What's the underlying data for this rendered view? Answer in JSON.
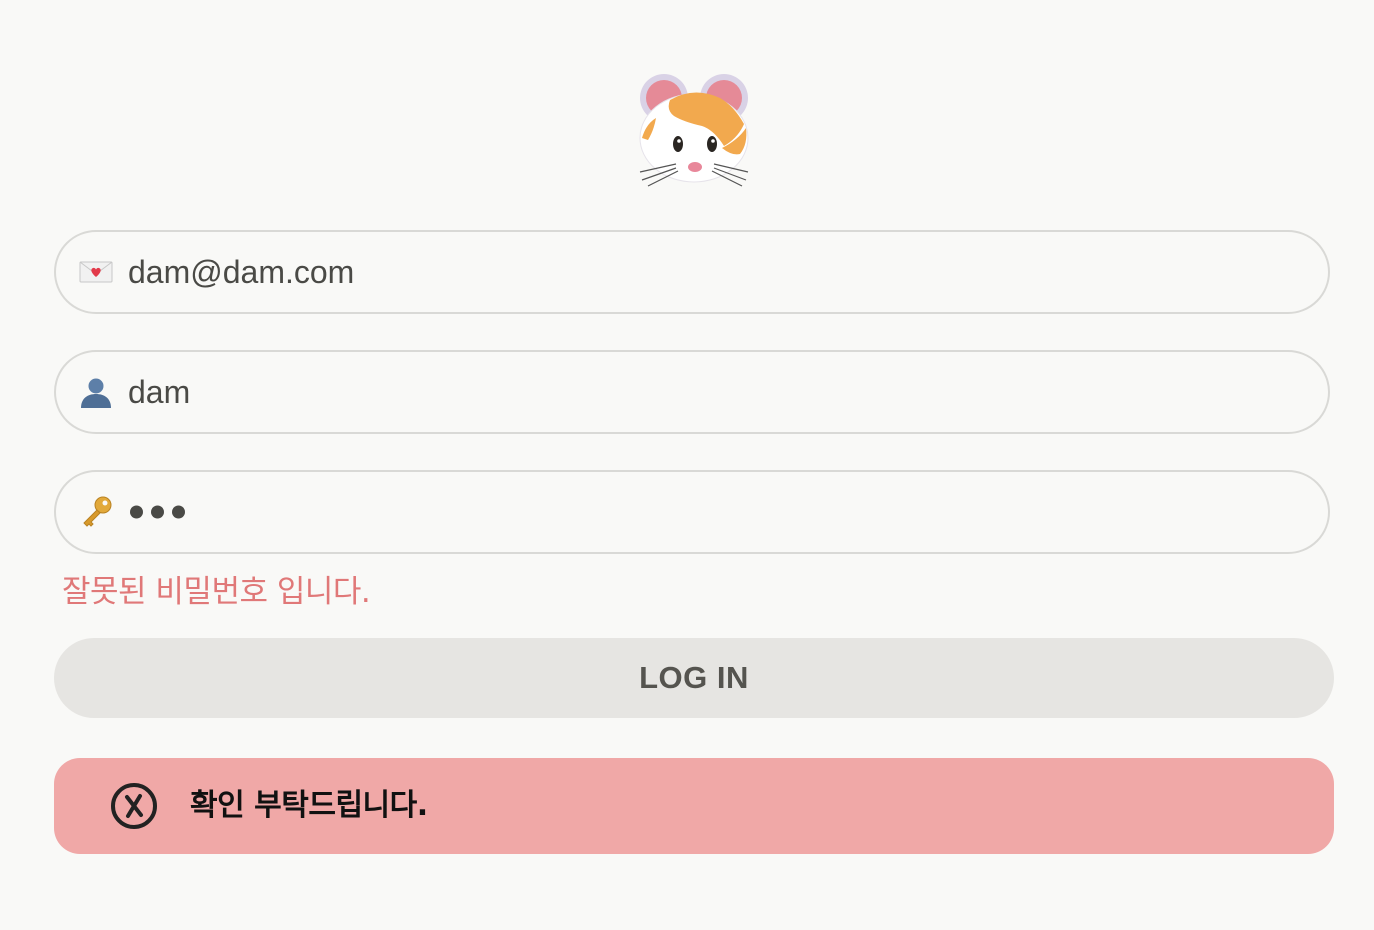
{
  "logo": {
    "icon": "hamster-face-icon"
  },
  "form": {
    "email": {
      "icon": "love-letter-icon",
      "value": "dam@dam.com"
    },
    "username": {
      "icon": "user-silhouette-icon",
      "value": "dam"
    },
    "password": {
      "icon": "key-icon",
      "masked_length": 3
    },
    "error_message": "잘못된 비밀번호 입니다.",
    "login_label": "LOG IN"
  },
  "toast": {
    "icon": "x-circle-icon",
    "message": "확인 부탁드립니다."
  },
  "colors": {
    "background": "#f9f9f7",
    "error_text": "#e07878",
    "toast_bg": "#f0a8a7",
    "button_bg": "#e6e5e2",
    "button_text": "#55544f"
  }
}
